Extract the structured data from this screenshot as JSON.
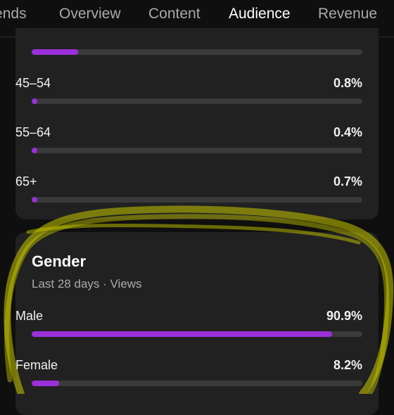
{
  "tabs": [
    {
      "label": "Trends"
    },
    {
      "label": "Overview"
    },
    {
      "label": "Content"
    },
    {
      "label": "Audience",
      "active": true
    },
    {
      "label": "Revenue"
    }
  ],
  "age_card": {
    "top_partial_fill": 0.14,
    "rows": [
      {
        "label": "45–54",
        "value": "0.8%",
        "fill": 0.008
      },
      {
        "label": "55–64",
        "value": "0.4%",
        "fill": 0.004
      },
      {
        "label": "65+",
        "value": "0.7%",
        "fill": 0.007
      }
    ]
  },
  "gender_card": {
    "title": "Gender",
    "subtitle": "Last 28 days · Views",
    "rows": [
      {
        "label": "Male",
        "value": "90.9%",
        "fill": 0.909
      },
      {
        "label": "Female",
        "value": "8.2%",
        "fill": 0.082
      }
    ]
  },
  "colors": {
    "accent": "#9b30d9",
    "annotation": "#c8c800"
  }
}
